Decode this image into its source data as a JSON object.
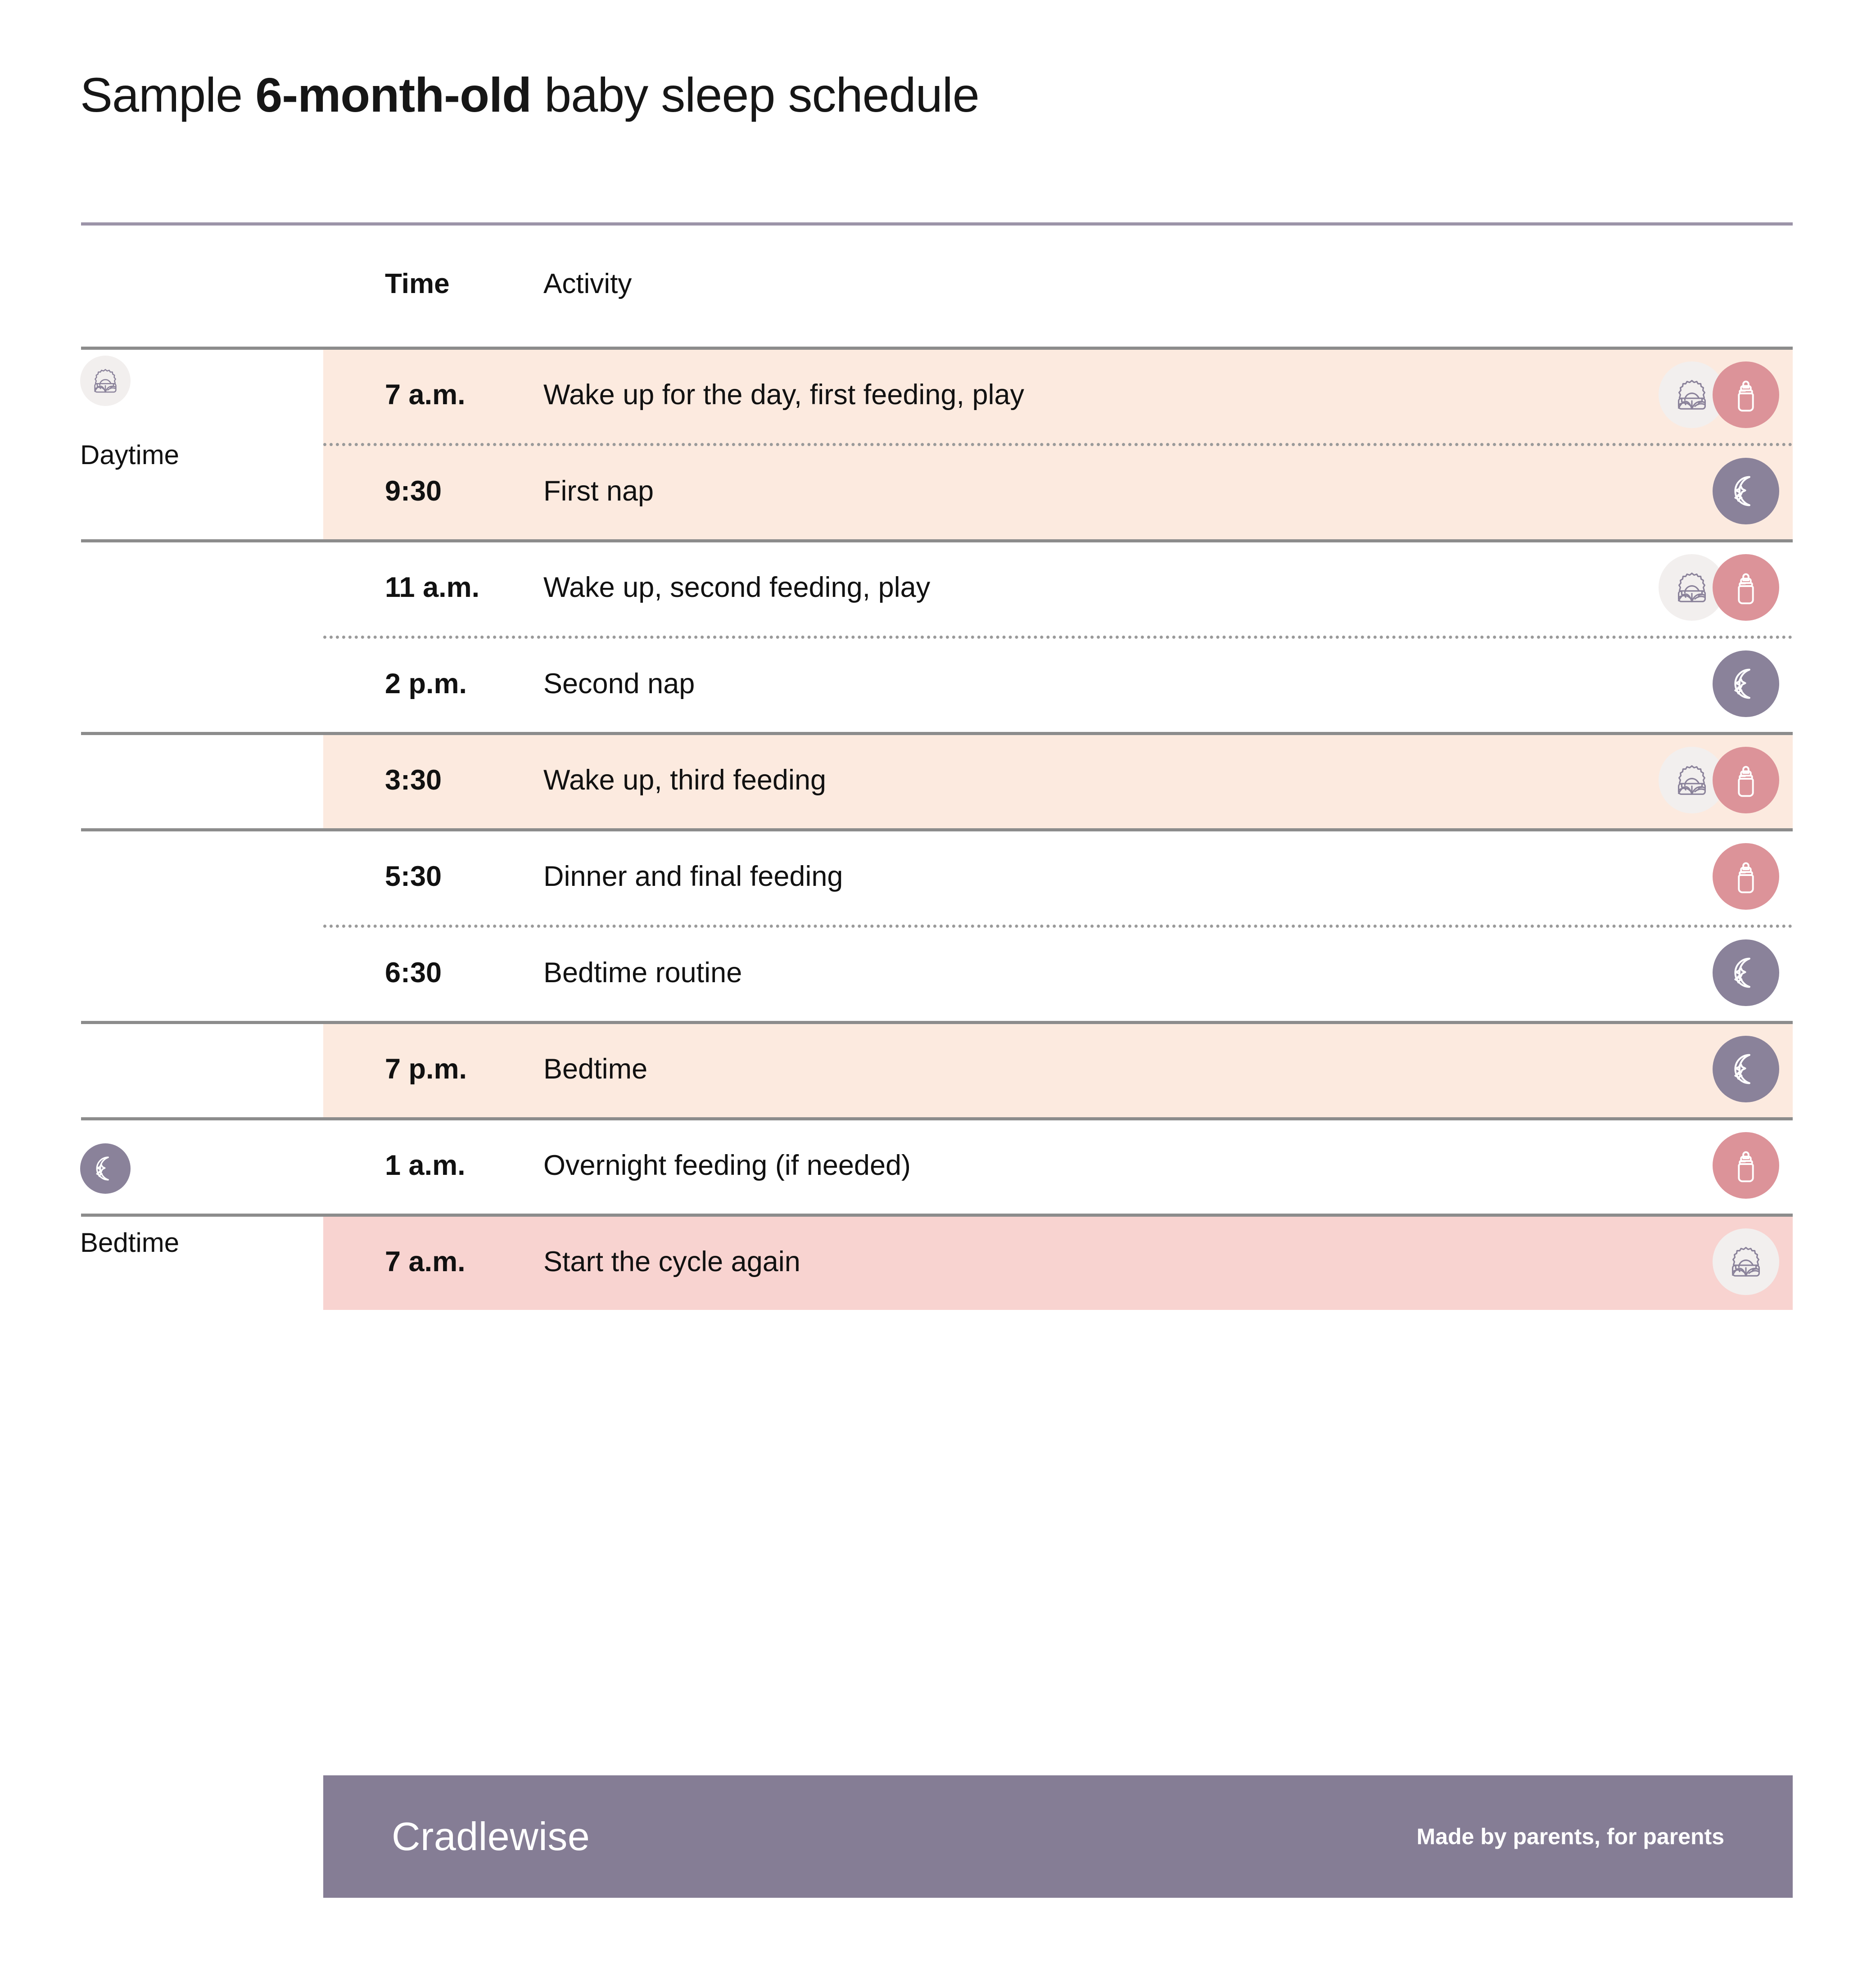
{
  "title": {
    "prefix": "Sample ",
    "emphasis": "6-month-old",
    "suffix": " baby sleep schedule"
  },
  "table_header": {
    "time": "Time",
    "activity": "Activity"
  },
  "sections": [
    {
      "id": "daytime",
      "label": "Daytime",
      "icon": "sunrise-icon"
    },
    {
      "id": "bedtime",
      "label": "Bedtime",
      "icon": "moon-icon"
    }
  ],
  "rows": [
    {
      "time": "7 a.m.",
      "activity": "Wake up for the day, first feeding, play",
      "icons": [
        "sunrise-icon",
        "bottle-icon"
      ],
      "band": "peach"
    },
    {
      "time": "9:30",
      "activity": "First nap",
      "icons": [
        "moon-icon"
      ],
      "band": "peach"
    },
    {
      "time": "11 a.m.",
      "activity": "Wake up, second feeding, play",
      "icons": [
        "sunrise-icon",
        "bottle-icon"
      ],
      "band": "none"
    },
    {
      "time": "2 p.m.",
      "activity": "Second nap",
      "icons": [
        "moon-icon"
      ],
      "band": "none"
    },
    {
      "time": "3:30",
      "activity": "Wake up, third feeding",
      "icons": [
        "sunrise-icon",
        "bottle-icon"
      ],
      "band": "peach"
    },
    {
      "time": "5:30",
      "activity": "Dinner and final feeding",
      "icons": [
        "bottle-icon"
      ],
      "band": "none"
    },
    {
      "time": "6:30",
      "activity": "Bedtime routine",
      "icons": [
        "moon-icon"
      ],
      "band": "none"
    },
    {
      "time": "7 p.m.",
      "activity": "Bedtime",
      "icons": [
        "moon-icon"
      ],
      "band": "peach"
    },
    {
      "time": "1 a.m.",
      "activity": "Overnight feeding (if needed)",
      "icons": [
        "bottle-icon"
      ],
      "band": "none"
    },
    {
      "time": "7 a.m.",
      "activity": "Start the cycle again",
      "icons": [
        "sunrise-icon"
      ],
      "band": "pink"
    }
  ],
  "footer": {
    "brand": "Cradlewise",
    "tagline": "Made by parents, for parents"
  },
  "colors": {
    "band_peach": "#FCEADF",
    "band_pink": "#F8D3D0",
    "icon_sunrise_bg": "#F2EFEE",
    "icon_sunrise_stroke": "#8A829A",
    "icon_bottle_bg": "#DC9399",
    "icon_moon_bg": "#8A829A",
    "footer_bg": "#857D95",
    "rule_top": "#9C94A8",
    "rule_solid": "#8C8C8C",
    "rule_dotted": "#9A9A9A"
  }
}
